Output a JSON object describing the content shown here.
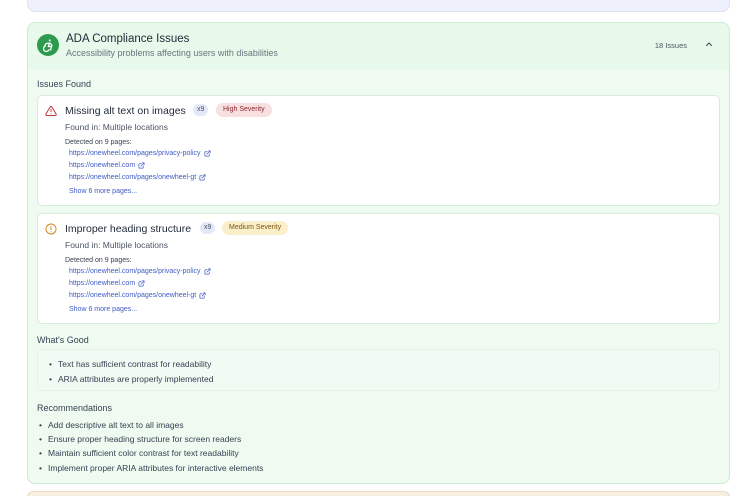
{
  "section": {
    "title": "ADA Compliance Issues",
    "subtitle": "Accessibility problems affecting users with disabilities",
    "count": "18 Issues",
    "icon": "accessibility-icon",
    "accent": "#2e9a4d"
  },
  "issues_heading": "Issues Found",
  "issues": [
    {
      "title": "Missing alt text on images",
      "multiplier": "x9",
      "severity": "High Severity",
      "icon": "warning-triangle-icon",
      "found_in": "Found in: Multiple locations",
      "detected": "Detected on 9 pages:",
      "pages": [
        "https://onewheel.com/pages/privacy-policy",
        "https://onewheel.com",
        "https://onewheel.com/pages/onewheel-gt"
      ],
      "show_more": "Show 6 more pages..."
    },
    {
      "title": "Improper heading structure",
      "multiplier": "x9",
      "severity": "Medium Severity",
      "icon": "alert-circle-icon",
      "found_in": "Found in: Multiple locations",
      "detected": "Detected on 9 pages:",
      "pages": [
        "https://onewheel.com/pages/privacy-policy",
        "https://onewheel.com",
        "https://onewheel.com/pages/onewheel-gt"
      ],
      "show_more": "Show 6 more pages..."
    }
  ],
  "good_heading": "What's Good",
  "good_items": [
    "Text has sufficient contrast for readability",
    "ARIA attributes are properly implemented"
  ],
  "rec_heading": "Recommendations",
  "recommendations": [
    "Add descriptive alt text to all images",
    "Ensure proper heading structure for screen readers",
    "Maintain sufficient color contrast for text readability",
    "Implement proper ARIA attributes for interactive elements"
  ]
}
